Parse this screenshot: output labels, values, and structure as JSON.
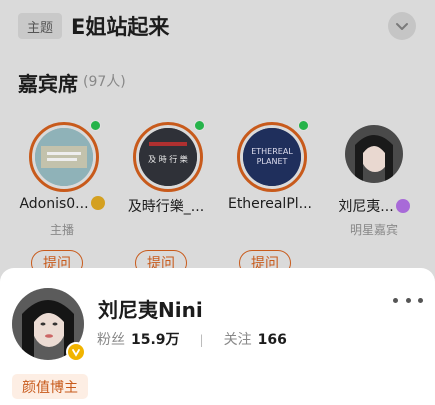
{
  "header": {
    "topic_tag": "主题",
    "topic_title": "E姐站起来"
  },
  "guests_section": {
    "title": "嘉宾席",
    "count": "(97人)"
  },
  "guests": [
    {
      "name": "Adonis0...",
      "role": "主播",
      "ask": "提问",
      "online": true,
      "badge": "gold-v-icon"
    },
    {
      "name": "及時行樂_...",
      "role": "",
      "ask": "提问",
      "online": true,
      "avatar_text": "及 時 行 樂"
    },
    {
      "name": "EtherealPl...",
      "role": "",
      "ask": "提问",
      "online": true,
      "avatar_text": "ETHEREAL PLANET"
    },
    {
      "name": "刘尼夷...",
      "role": "明星嘉宾",
      "ask": "",
      "online": false,
      "badge": "purple-star-icon"
    }
  ],
  "profile": {
    "name": "刘尼夷Nini",
    "fans_label": "粉丝",
    "fans_value": "15.9万",
    "separator": "|",
    "follow_label": "关注",
    "follow_value": "166",
    "tag": "颜值博主"
  },
  "colors": {
    "accent": "#c85a1b",
    "online": "#26b34a",
    "verified": "#f1b400",
    "star_badge": "#a86ad8"
  }
}
